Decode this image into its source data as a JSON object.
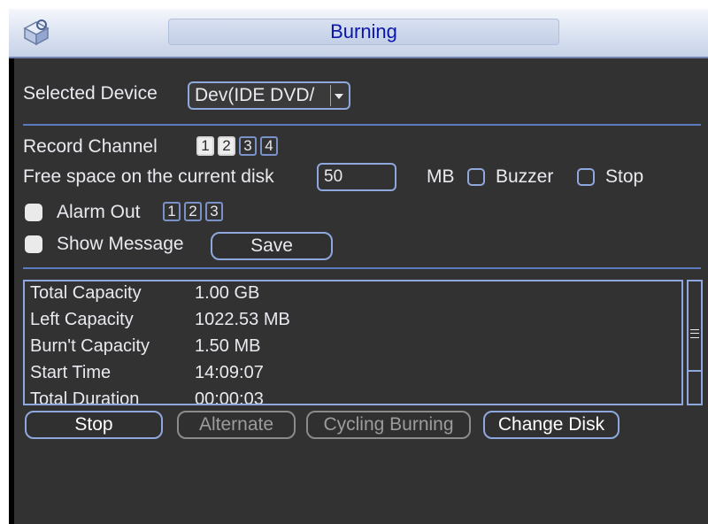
{
  "window": {
    "title": "Burning",
    "icon": "settings-cube-icon"
  },
  "device": {
    "label": "Selected Device",
    "value": "Dev(IDE DVD/"
  },
  "record": {
    "label": "Record Channel",
    "channels": [
      {
        "n": "1",
        "checked": true
      },
      {
        "n": "2",
        "checked": true
      },
      {
        "n": "3",
        "checked": false
      },
      {
        "n": "4",
        "checked": false
      }
    ]
  },
  "free_space": {
    "label": "Free space on the current disk",
    "value": "50",
    "unit": "MB"
  },
  "buzzer": {
    "label": "Buzzer",
    "checked": false
  },
  "stop_option": {
    "label": "Stop",
    "checked": false
  },
  "alarm_out": {
    "label": "Alarm Out",
    "checked": true,
    "channels": [
      "1",
      "2",
      "3"
    ]
  },
  "show_message": {
    "label": "Show Message",
    "checked": true
  },
  "save_label": "Save",
  "info": {
    "rows": [
      {
        "label": "Total Capacity",
        "value": "1.00 GB"
      },
      {
        "label": "Left Capacity",
        "value": "1022.53 MB"
      },
      {
        "label": "Burn't Capacity",
        "value": "1.50 MB"
      },
      {
        "label": "Start Time",
        "value": "14:09:07"
      },
      {
        "label": "Total Duration",
        "value": "00:00:03"
      }
    ]
  },
  "buttons": {
    "stop": "Stop",
    "alternate": "Alternate",
    "cycling": "Cycling Burning",
    "change_disk": "Change Disk"
  }
}
